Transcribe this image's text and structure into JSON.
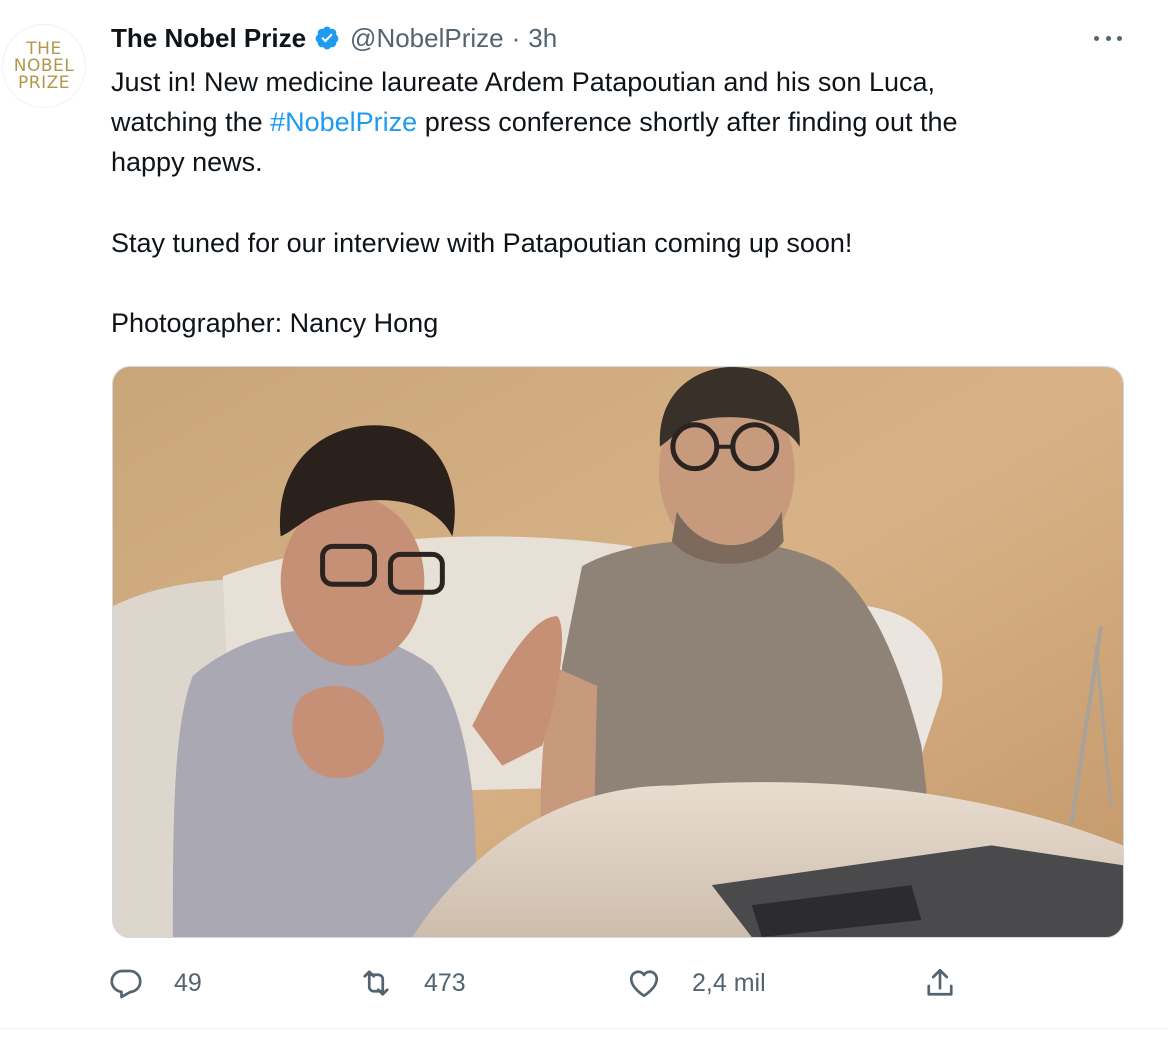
{
  "author": {
    "display_name": "The Nobel Prize",
    "handle": "@NobelPrize",
    "separator": "·",
    "time": "3h",
    "avatar_lines": [
      "THE",
      "NOBEL",
      "PRIZE"
    ]
  },
  "body": {
    "p1_before": "Just in! New medicine laureate Ardem Patapoutian and his son Luca,\nwatching the ",
    "p1_hashtag": "#NobelPrize",
    "p1_after": " press conference shortly after finding out the\nhappy news.",
    "p2": "Stay tuned for our interview with Patapoutian coming up soon!",
    "p3": "Photographer: Nancy Hong"
  },
  "actions": {
    "reply_count": "49",
    "retweet_count": "473",
    "like_count": "2,4 mil"
  },
  "icons": {
    "verified": "verified-badge-icon",
    "more": "more-options-icon",
    "reply": "reply-icon",
    "retweet": "retweet-icon",
    "like": "heart-icon",
    "share": "share-icon"
  },
  "colors": {
    "text": "#0f1419",
    "secondary": "#536471",
    "link": "#1d9bf0",
    "verified": "#1d9bf0",
    "logo_gold": "#b39749"
  }
}
